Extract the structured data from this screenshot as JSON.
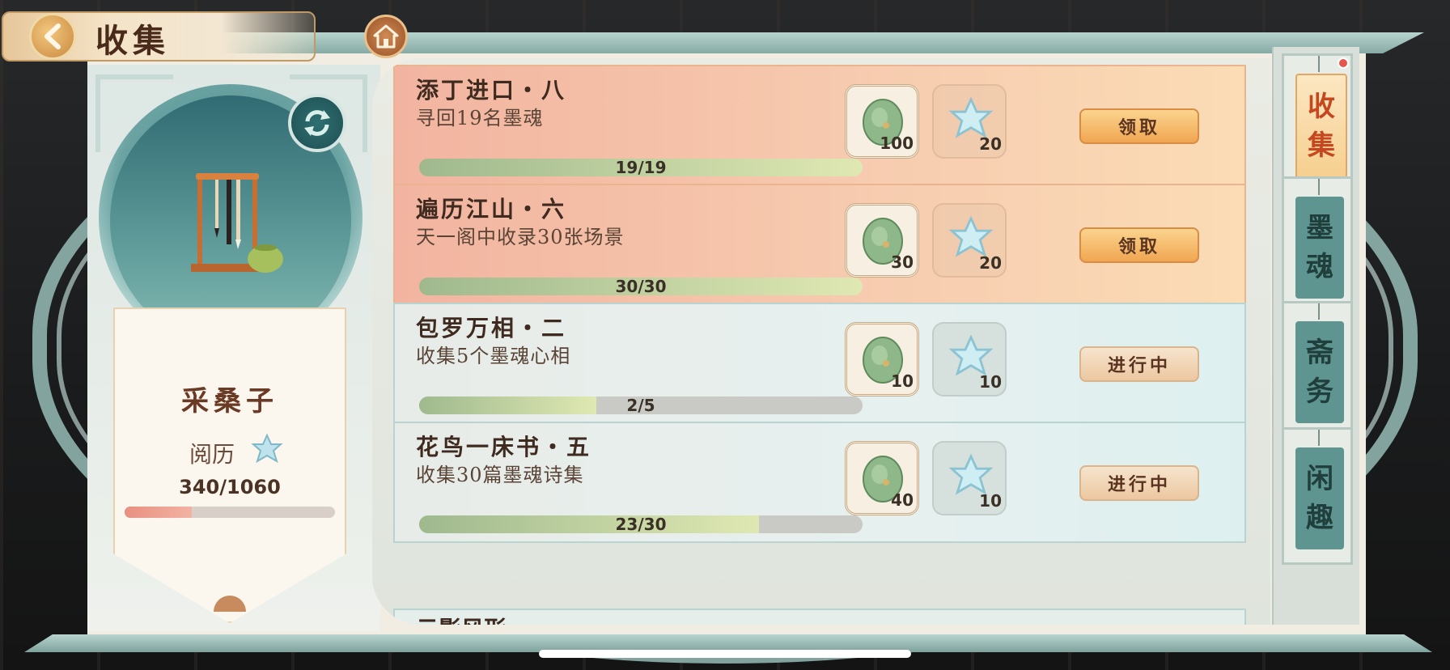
{
  "header": {
    "title": "收集"
  },
  "icons": {
    "back": "back-arrow-icon",
    "home": "home-icon",
    "refresh": "refresh-icon",
    "jade": "jade-coin-icon",
    "star": "star-crystal-icon"
  },
  "character": {
    "name": "采桑子",
    "exp_label": "阅历",
    "exp_value": "340/1060",
    "exp_progress": 0.32
  },
  "tasks": [
    {
      "title": "添丁进口・八",
      "desc": "寻回19名墨魂",
      "progress_text": "19/19",
      "progress": 1.0,
      "rewards": {
        "jade": "100",
        "star": "20"
      },
      "button": "领取",
      "state": "done"
    },
    {
      "title": "遍历江山・六",
      "desc": "天一阁中收录30张场景",
      "progress_text": "30/30",
      "progress": 1.0,
      "rewards": {
        "jade": "30",
        "star": "20"
      },
      "button": "领取",
      "state": "done"
    },
    {
      "title": "包罗万相・二",
      "desc": "收集5个墨魂心相",
      "progress_text": "2/5",
      "progress": 0.4,
      "rewards": {
        "jade": "10",
        "star": "10"
      },
      "button": "进行中",
      "state": "prog"
    },
    {
      "title": "花鸟一床书・五",
      "desc": "收集30篇墨魂诗集",
      "progress_text": "23/30",
      "progress": 0.7667,
      "rewards": {
        "jade": "40",
        "star": "10"
      },
      "button": "进行中",
      "state": "prog"
    }
  ],
  "partial_task": {
    "title": "云影风形・"
  },
  "tabs": [
    {
      "label_top": "收",
      "label_bottom": "集",
      "active": true,
      "badge": true
    },
    {
      "label_top": "墨",
      "label_bottom": "魂",
      "active": false
    },
    {
      "label_top": "斋",
      "label_bottom": "务",
      "active": false
    },
    {
      "label_top": "闲",
      "label_bottom": "趣",
      "active": false
    }
  ],
  "colors": {
    "done_card": "#f2b4a0",
    "progress_card": "#e6f0ef",
    "accent_tab_text": "#c4471f",
    "claim_button": "#f0a652"
  }
}
